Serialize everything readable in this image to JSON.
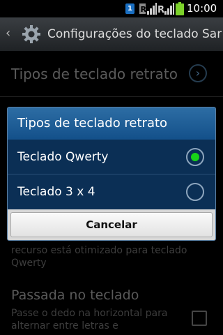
{
  "status_bar": {
    "notification_badge": "1",
    "time": "10:00",
    "icons": [
      "notification-icon",
      "signal-r-icon",
      "signal-icon",
      "battery-icon"
    ]
  },
  "action_bar": {
    "title": "Configurações do teclado Samsung",
    "icons": [
      "back-chevron-icon",
      "gear-icon"
    ]
  },
  "settings": {
    "portrait_keyboard_types_label": "Tipos de teclado retrato",
    "partial_description": "recurso está otimizado para teclado Qwerty",
    "keyboard_swipe_label": "Passada no teclado",
    "keyboard_swipe_description": "Passe o dedo na horizontal para alternar entre letras e",
    "keyboard_swipe_checked": false
  },
  "dialog": {
    "title": "Tipos de teclado retrato",
    "options": [
      {
        "label": "Teclado Qwerty",
        "selected": true
      },
      {
        "label": "Teclado 3 x 4",
        "selected": false
      }
    ],
    "cancel_label": "Cancelar",
    "accent_color": "#18d418"
  }
}
